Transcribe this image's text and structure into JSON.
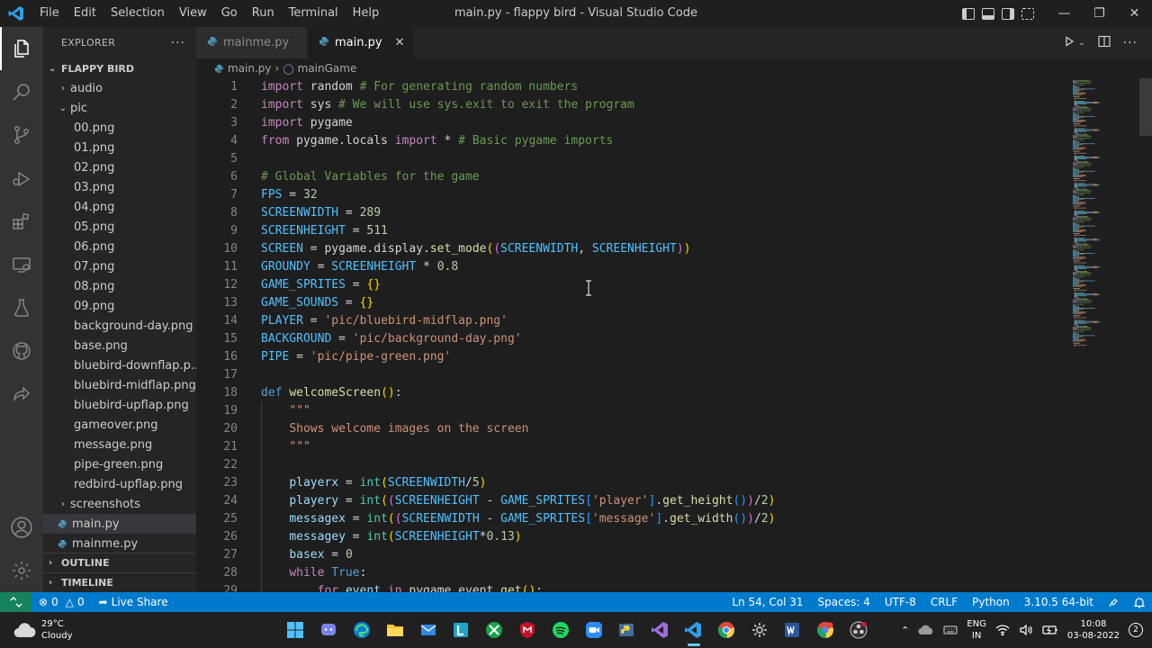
{
  "window": {
    "title": "main.py - flappy bird - Visual Studio Code",
    "menu": [
      "File",
      "Edit",
      "Selection",
      "View",
      "Go",
      "Run",
      "Terminal",
      "Help"
    ]
  },
  "sidebar": {
    "header": "EXPLORER",
    "folder": "FLAPPY BIRD",
    "tree": [
      {
        "label": "audio",
        "type": "folder",
        "open": false,
        "depth": 1
      },
      {
        "label": "pic",
        "type": "folder",
        "open": true,
        "depth": 1
      },
      {
        "label": "00.png",
        "type": "file",
        "depth": 2
      },
      {
        "label": "01.png",
        "type": "file",
        "depth": 2
      },
      {
        "label": "02.png",
        "type": "file",
        "depth": 2
      },
      {
        "label": "03.png",
        "type": "file",
        "depth": 2
      },
      {
        "label": "04.png",
        "type": "file",
        "depth": 2
      },
      {
        "label": "05.png",
        "type": "file",
        "depth": 2
      },
      {
        "label": "06.png",
        "type": "file",
        "depth": 2
      },
      {
        "label": "07.png",
        "type": "file",
        "depth": 2
      },
      {
        "label": "08.png",
        "type": "file",
        "depth": 2
      },
      {
        "label": "09.png",
        "type": "file",
        "depth": 2
      },
      {
        "label": "background-day.png",
        "type": "file",
        "depth": 2
      },
      {
        "label": "base.png",
        "type": "file",
        "depth": 2
      },
      {
        "label": "bluebird-downflap.p...",
        "type": "file",
        "depth": 2
      },
      {
        "label": "bluebird-midflap.png",
        "type": "file",
        "depth": 2
      },
      {
        "label": "bluebird-upflap.png",
        "type": "file",
        "depth": 2
      },
      {
        "label": "gameover.png",
        "type": "file",
        "depth": 2
      },
      {
        "label": "message.png",
        "type": "file",
        "depth": 2
      },
      {
        "label": "pipe-green.png",
        "type": "file",
        "depth": 2
      },
      {
        "label": "redbird-upflap.png",
        "type": "file",
        "depth": 2
      },
      {
        "label": "screenshots",
        "type": "folder",
        "open": false,
        "depth": 1
      },
      {
        "label": "main.py",
        "type": "py",
        "depth": 1,
        "selected": true
      },
      {
        "label": "mainme.py",
        "type": "py",
        "depth": 1
      }
    ],
    "outline": "OUTLINE",
    "timeline": "TIMELINE"
  },
  "tabs": [
    {
      "label": "mainme.py",
      "active": false
    },
    {
      "label": "main.py",
      "active": true
    }
  ],
  "breadcrumb": [
    "main.py",
    "mainGame"
  ],
  "editor": {
    "lines": [
      [
        [
          "kw",
          "import"
        ],
        [
          "p",
          " "
        ],
        [
          "p",
          "random"
        ],
        [
          "p",
          " "
        ],
        [
          "cm",
          "# For generating random numbers"
        ]
      ],
      [
        [
          "kw",
          "import"
        ],
        [
          "p",
          " sys "
        ],
        [
          "cm",
          "# We will use sys.exit to exit the program"
        ]
      ],
      [
        [
          "kw",
          "import"
        ],
        [
          "p",
          " pygame"
        ]
      ],
      [
        [
          "kw",
          "from"
        ],
        [
          "p",
          " pygame.locals "
        ],
        [
          "kw",
          "import"
        ],
        [
          "p",
          " * "
        ],
        [
          "cm",
          "# Basic pygame imports"
        ]
      ],
      [],
      [
        [
          "cm",
          "# Global Variables for the game"
        ]
      ],
      [
        [
          "cv",
          "FPS"
        ],
        [
          "p",
          " = "
        ],
        [
          "nu",
          "32"
        ]
      ],
      [
        [
          "cv",
          "SCREENWIDTH"
        ],
        [
          "p",
          " = "
        ],
        [
          "nu",
          "289"
        ]
      ],
      [
        [
          "cv",
          "SCREENHEIGHT"
        ],
        [
          "p",
          " = "
        ],
        [
          "nu",
          "511"
        ]
      ],
      [
        [
          "cv",
          "SCREEN"
        ],
        [
          "p",
          " = pygame.display."
        ],
        [
          "fn",
          "set_mode"
        ],
        [
          "br3",
          "("
        ],
        [
          "br",
          "("
        ],
        [
          "cv",
          "SCREENWIDTH"
        ],
        [
          "p",
          ", "
        ],
        [
          "cv",
          "SCREENHEIGHT"
        ],
        [
          "br",
          ")"
        ],
        [
          "br3",
          ")"
        ]
      ],
      [
        [
          "cv",
          "GROUNDY"
        ],
        [
          "p",
          " = "
        ],
        [
          "cv",
          "SCREENHEIGHT"
        ],
        [
          "p",
          " * "
        ],
        [
          "nu",
          "0.8"
        ]
      ],
      [
        [
          "cv",
          "GAME_SPRITES"
        ],
        [
          "p",
          " = "
        ],
        [
          "br3",
          "{}"
        ]
      ],
      [
        [
          "cv",
          "GAME_SOUNDS"
        ],
        [
          "p",
          " = "
        ],
        [
          "br3",
          "{}"
        ]
      ],
      [
        [
          "cv",
          "PLAYER"
        ],
        [
          "p",
          " = "
        ],
        [
          "st",
          "'pic/bluebird-midflap.png'"
        ]
      ],
      [
        [
          "cv",
          "BACKGROUND"
        ],
        [
          "p",
          " = "
        ],
        [
          "st",
          "'pic/background-day.png'"
        ]
      ],
      [
        [
          "cv",
          "PIPE"
        ],
        [
          "p",
          " = "
        ],
        [
          "st",
          "'pic/pipe-green.png'"
        ]
      ],
      [],
      [
        [
          "kd",
          "def"
        ],
        [
          "p",
          " "
        ],
        [
          "fn",
          "welcomeScreen"
        ],
        [
          "br3",
          "()"
        ],
        [
          "p",
          ":"
        ]
      ],
      [
        [
          "p",
          "    "
        ],
        [
          "doc",
          "\"\"\""
        ]
      ],
      [
        [
          "p",
          "    "
        ],
        [
          "doc",
          "Shows welcome images on the screen"
        ]
      ],
      [
        [
          "p",
          "    "
        ],
        [
          "doc",
          "\"\"\""
        ]
      ],
      [],
      [
        [
          "p",
          "    "
        ],
        [
          "vr",
          "playerx"
        ],
        [
          "p",
          " = "
        ],
        [
          "bi",
          "int"
        ],
        [
          "br3",
          "("
        ],
        [
          "cv",
          "SCREENWIDTH"
        ],
        [
          "p",
          "/"
        ],
        [
          "nu",
          "5"
        ],
        [
          "br3",
          ")"
        ]
      ],
      [
        [
          "p",
          "    "
        ],
        [
          "vr",
          "playery"
        ],
        [
          "p",
          " = "
        ],
        [
          "bi",
          "int"
        ],
        [
          "br3",
          "("
        ],
        [
          "br",
          "("
        ],
        [
          "cv",
          "SCREENHEIGHT"
        ],
        [
          "p",
          " - "
        ],
        [
          "cv",
          "GAME_SPRITES"
        ],
        [
          "br2",
          "["
        ],
        [
          "st",
          "'player'"
        ],
        [
          "br2",
          "]"
        ],
        [
          "p",
          "."
        ],
        [
          "fn",
          "get_height"
        ],
        [
          "br2",
          "()"
        ],
        [
          "br",
          ")"
        ],
        [
          "p",
          "/"
        ],
        [
          "nu",
          "2"
        ],
        [
          "br3",
          ")"
        ]
      ],
      [
        [
          "p",
          "    "
        ],
        [
          "vr",
          "messagex"
        ],
        [
          "p",
          " = "
        ],
        [
          "bi",
          "int"
        ],
        [
          "br3",
          "("
        ],
        [
          "br",
          "("
        ],
        [
          "cv",
          "SCREENWIDTH"
        ],
        [
          "p",
          " - "
        ],
        [
          "cv",
          "GAME_SPRITES"
        ],
        [
          "br2",
          "["
        ],
        [
          "st",
          "'message'"
        ],
        [
          "br2",
          "]"
        ],
        [
          "p",
          "."
        ],
        [
          "fn",
          "get_width"
        ],
        [
          "br2",
          "()"
        ],
        [
          "br",
          ")"
        ],
        [
          "p",
          "/"
        ],
        [
          "nu",
          "2"
        ],
        [
          "br3",
          ")"
        ]
      ],
      [
        [
          "p",
          "    "
        ],
        [
          "vr",
          "messagey"
        ],
        [
          "p",
          " = "
        ],
        [
          "bi",
          "int"
        ],
        [
          "br3",
          "("
        ],
        [
          "cv",
          "SCREENHEIGHT"
        ],
        [
          "p",
          "*"
        ],
        [
          "nu",
          "0.13"
        ],
        [
          "br3",
          ")"
        ]
      ],
      [
        [
          "p",
          "    "
        ],
        [
          "vr",
          "basex"
        ],
        [
          "p",
          " = "
        ],
        [
          "nu",
          "0"
        ]
      ],
      [
        [
          "p",
          "    "
        ],
        [
          "kw",
          "while"
        ],
        [
          "p",
          " "
        ],
        [
          "kd",
          "True"
        ],
        [
          "p",
          ":"
        ]
      ],
      [
        [
          "p",
          "        "
        ],
        [
          "kw",
          "for"
        ],
        [
          "p",
          " "
        ],
        [
          "vr",
          "event"
        ],
        [
          "p",
          " "
        ],
        [
          "kw",
          "in"
        ],
        [
          "p",
          " pygame.event."
        ],
        [
          "fn",
          "get"
        ],
        [
          "br3",
          "()"
        ],
        [
          "p",
          ":"
        ]
      ]
    ]
  },
  "status": {
    "errors": "0",
    "warnings": "0",
    "live_share": "Live Share",
    "position": "Ln 54, Col 31",
    "spaces": "Spaces: 4",
    "encoding": "UTF-8",
    "eol": "CRLF",
    "language": "Python",
    "interpreter": "3.10.5 64-bit"
  },
  "taskbar": {
    "temp": "29°C",
    "weather": "Cloudy",
    "lang": "ENG",
    "region": "IN",
    "time": "10:08",
    "date": "03-08-2022",
    "notifications": "2"
  },
  "colors": {
    "accent": "#007acc",
    "remote": "#16825d"
  }
}
